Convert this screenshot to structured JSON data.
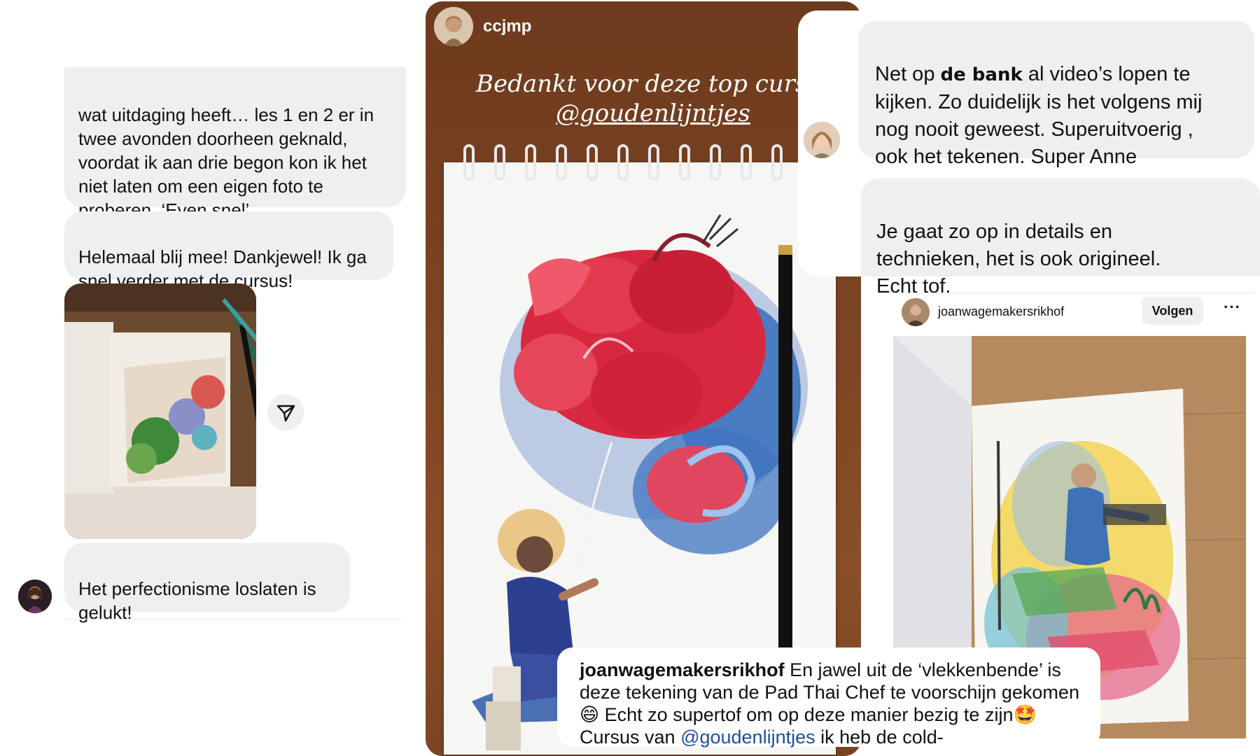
{
  "left_chat": {
    "message_1": "wat uitdaging heeft… les 1 en 2 er  in\ntwee avonden doorheen geknald,\nvoordat ik aan drie begon kon ik het\nniet laten om een eigen foto te\nproberen. ‘Even snel’",
    "message_2": "Helemaal blij mee! Dankjewel! Ik ga\nsnel verder met de cursus!",
    "message_3": "Het perfectionisme loslaten is\ngelukt!",
    "share_icon": "paper-plane-icon"
  },
  "story": {
    "username": "ccjmp",
    "caption_line1": "Bedankt voor deze top cursus",
    "caption_line2": "@goudenlijntjes"
  },
  "right_chat": {
    "message_1_part1": "Net op ",
    "message_1_keyword": "de bank",
    "message_1_part2": " al video’s lopen te\nkijken. Zo duidelijk is het volgens mij\nnog nooit geweest. Superuitvoerig ,\nook het tekenen. Super Anne",
    "message_2": "Je gaat zo op in details en\ntechnieken, het is ook origineel.\nEcht tof."
  },
  "post": {
    "username": "joanwagemakersrikhof",
    "follow_label": "Volgen",
    "more_label": "···"
  },
  "comment": {
    "username": "joanwagemakersrikhof",
    "text_1": " En jawel uit de ‘vlekkenbende’ is deze tekening van de Pad Thai Chef te voorschijn gekomen",
    "emoji_1": "😄",
    "text_2": " Echt zo supertof om op deze manier bezig te zijn",
    "emoji_2": "🤩",
    "text_3": " Cursus van ",
    "mention": "@goudenlijntjes",
    "text_4": " ik heb de cold-"
  },
  "colors": {
    "bubble": "#efeff1",
    "story_bg": "#7b4423",
    "mention": "#1f4fa0"
  }
}
